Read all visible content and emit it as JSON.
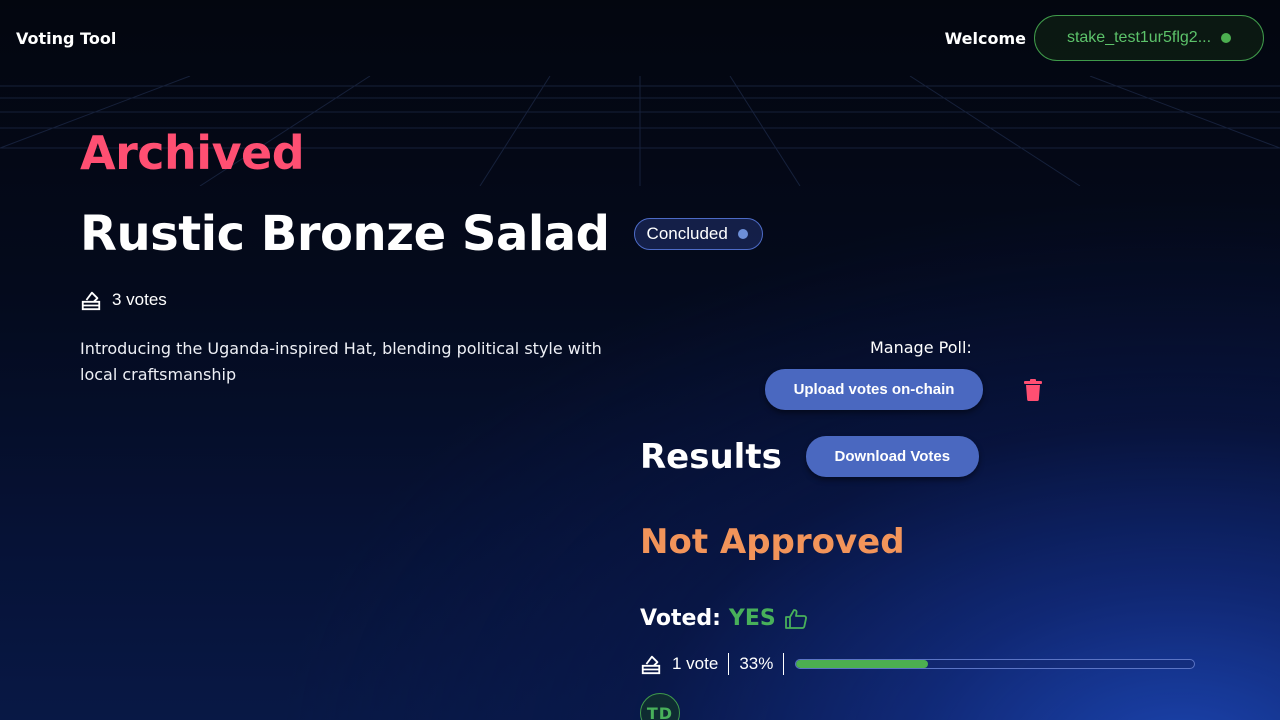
{
  "header": {
    "brand": "Voting Tool",
    "welcome": "Welcome",
    "wallet_address": "stake_test1ur5flg2..."
  },
  "poll": {
    "section_label": "Archived",
    "title": "Rustic Bronze Salad",
    "status": "Concluded",
    "vote_count_label": "3 votes",
    "description": "Introducing the Uganda-inspired Hat, blending political style with local craftsmanship"
  },
  "manage": {
    "label": "Manage Poll:",
    "upload_button": "Upload votes on-chain",
    "delete_icon": "trash-icon"
  },
  "results": {
    "title": "Results",
    "download_button": "Download Votes",
    "outcome": "Not Approved",
    "voted_label": "Voted:",
    "voted_value": "YES",
    "vote_count": "1 vote",
    "percent_label": "33%",
    "percent_value": 33,
    "avatar_initials": "TD"
  },
  "colors": {
    "archived": "#ff4f72",
    "outcome": "#f2945a",
    "yes": "#48b05a",
    "button": "#4a68c0"
  }
}
